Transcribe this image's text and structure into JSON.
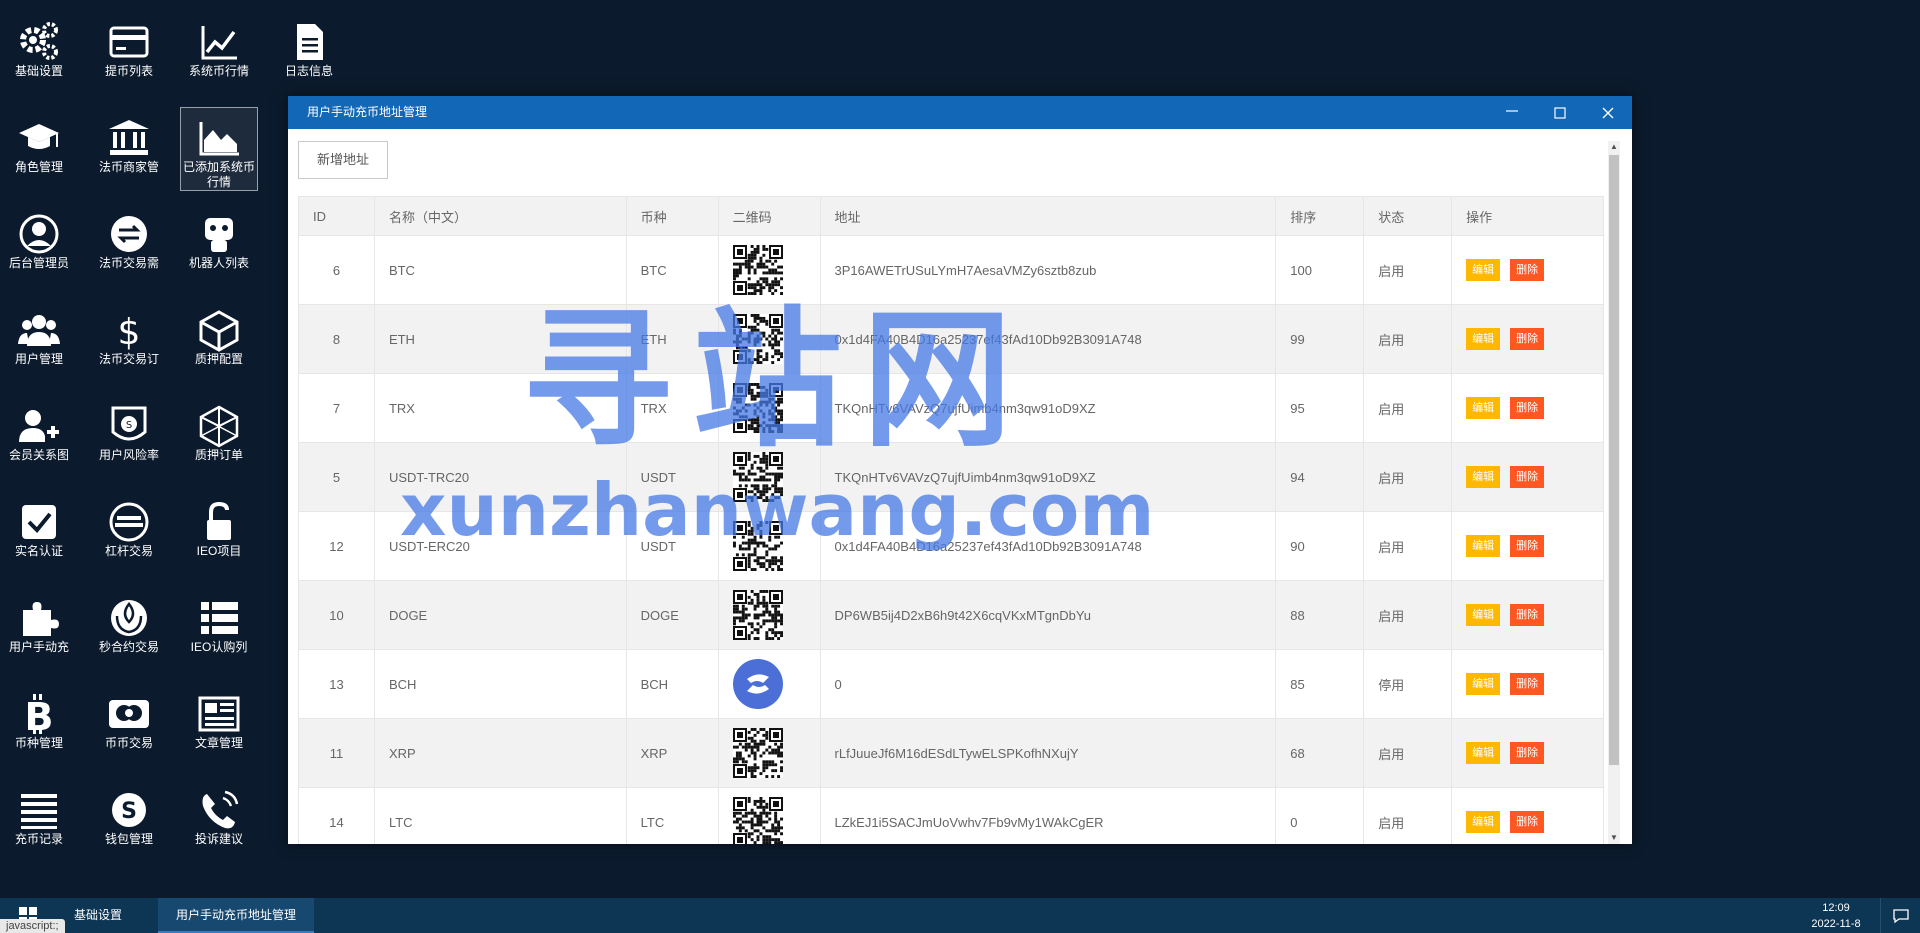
{
  "desktop": {
    "icons": [
      {
        "label": "基础设置",
        "icon": "gears-icon"
      },
      {
        "label": "提币列表",
        "icon": "credit-card-icon"
      },
      {
        "label": "系统币行情",
        "icon": "line-chart-icon"
      },
      {
        "label": "日志信息",
        "icon": "document-icon"
      },
      {
        "label": "角色管理",
        "icon": "graduation-cap-icon"
      },
      {
        "label": "法币商家管",
        "icon": "bank-icon"
      },
      {
        "label": "已添加系统币行情",
        "icon": "area-chart-icon"
      },
      {
        "label": "后台管理员",
        "icon": "user-circle-icon"
      },
      {
        "label": "法币交易需",
        "icon": "exchange-icon"
      },
      {
        "label": "机器人列表",
        "icon": "robot-icon"
      },
      {
        "label": "用户管理",
        "icon": "users-icon"
      },
      {
        "label": "法币交易订",
        "icon": "dollar-icon"
      },
      {
        "label": "质押配置",
        "icon": "cube-icon"
      },
      {
        "label": "会员关系图",
        "icon": "user-plus-icon"
      },
      {
        "label": "用户风险率",
        "icon": "shield-coin-icon"
      },
      {
        "label": "质押订单",
        "icon": "polyhedron-icon"
      },
      {
        "label": "实名认证",
        "icon": "checkbox-icon"
      },
      {
        "label": "杠杆交易",
        "icon": "ethereum-icon"
      },
      {
        "label": "IEO项目",
        "icon": "unlock-icon"
      },
      {
        "label": "用户手动充",
        "icon": "puzzle-icon"
      },
      {
        "label": "秒合约交易",
        "icon": "rebel-icon"
      },
      {
        "label": "IEO认购列",
        "icon": "list-icon"
      },
      {
        "label": "币种管理",
        "icon": "bitcoin-icon"
      },
      {
        "label": "币币交易",
        "icon": "mastercard-icon"
      },
      {
        "label": "文章管理",
        "icon": "newspaper-icon"
      },
      {
        "label": "充币记录",
        "icon": "lines-icon"
      },
      {
        "label": "钱包管理",
        "icon": "skype-icon"
      },
      {
        "label": "投诉建议",
        "icon": "phone-icon"
      }
    ]
  },
  "window": {
    "title": "用户手动充币地址管理",
    "add_button": "新增地址",
    "columns": [
      "ID",
      "名称（中文）",
      "币种",
      "二维码",
      "地址",
      "排序",
      "状态",
      "操作"
    ],
    "edit_label": "编辑",
    "delete_label": "删除",
    "rows": [
      {
        "id": "6",
        "name": "BTC",
        "coin": "BTC",
        "qr": "qr",
        "address": "3P16AWETrUSuLYmH7AesaVMZy6sztb8zub",
        "sort": "100",
        "status": "启用"
      },
      {
        "id": "8",
        "name": "ETH",
        "coin": "ETH",
        "qr": "qr",
        "address": "0x1d4FA40B4D16a25237ef43fAd10Db92B3091A748",
        "sort": "99",
        "status": "启用"
      },
      {
        "id": "7",
        "name": "TRX",
        "coin": "TRX",
        "qr": "qr",
        "address": "TKQnHTv6VAVzQ7ujfUimb4nm3qw91oD9XZ",
        "sort": "95",
        "status": "启用"
      },
      {
        "id": "5",
        "name": "USDT-TRC20",
        "coin": "USDT",
        "qr": "qr",
        "address": "TKQnHTv6VAVzQ7ujfUimb4nm3qw91oD9XZ",
        "sort": "94",
        "status": "启用"
      },
      {
        "id": "12",
        "name": "USDT-ERC20",
        "coin": "USDT",
        "qr": "qr",
        "address": "0x1d4FA40B4D16a25237ef43fAd10Db92B3091A748",
        "sort": "90",
        "status": "启用"
      },
      {
        "id": "10",
        "name": "DOGE",
        "coin": "DOGE",
        "qr": "qr",
        "address": "DP6WB5ij4D2xB6h9t42X6cqVKxMTgnDbYu",
        "sort": "88",
        "status": "启用"
      },
      {
        "id": "13",
        "name": "BCH",
        "coin": "BCH",
        "qr": "logo",
        "address": "0",
        "sort": "85",
        "status": "停用"
      },
      {
        "id": "11",
        "name": "XRP",
        "coin": "XRP",
        "qr": "qr",
        "address": "rLfJuueJf6M16dESdLTywELSPKofhNXujY",
        "sort": "68",
        "status": "启用"
      },
      {
        "id": "14",
        "name": "LTC",
        "coin": "LTC",
        "qr": "qr",
        "address": "LZkEJ1i5SACJmUoVwhv7Fb9vMy1WAkCgER",
        "sort": "0",
        "status": "启用"
      }
    ]
  },
  "watermark": {
    "cn": "寻站网",
    "en": "xunzhanwang.com"
  },
  "taskbar": {
    "items": [
      "基础设置",
      "用户手动充币地址管理"
    ],
    "time": "12:09",
    "date": "2022-11-8",
    "status_tip": "javascript:;"
  },
  "colors": {
    "desktop_bg": "#0b1a2c",
    "titlebar": "#1267b7",
    "edit": "#ffb800",
    "delete": "#ff5722",
    "taskbar": "#0d3554"
  }
}
